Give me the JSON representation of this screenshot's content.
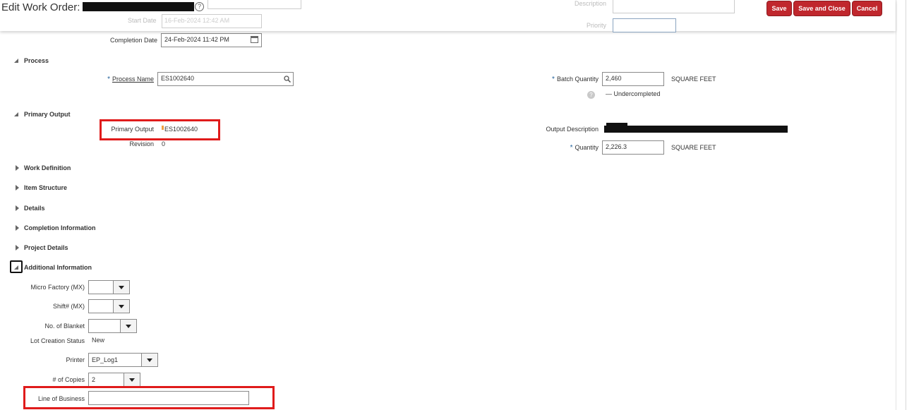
{
  "header": {
    "title": "Edit Work Order:",
    "help": "?",
    "start_date_label": "Start Date",
    "start_date_value": "16-Feb-2024 12:42 AM",
    "description_label": "Description",
    "priority_label": "Priority",
    "buttons": {
      "save": "Save",
      "save_close": "Save and Close",
      "cancel": "Cancel"
    }
  },
  "dates": {
    "completion_label": "Completion Date",
    "completion_value": "24-Feb-2024 11:42 PM"
  },
  "process": {
    "section": "Process",
    "name_label": "Process Name",
    "name_value": "ES1002640",
    "batch_qty_label": "Batch Quantity",
    "batch_qty_value": "2,460",
    "batch_uom": "SQUARE FEET",
    "undercompleted": "Undercompleted"
  },
  "primary_output": {
    "section": "Primary Output",
    "label": "Primary Output",
    "value": "ES1002640",
    "revision_label": "Revision",
    "revision_value": "0",
    "output_desc_label": "Output Description",
    "quantity_label": "Quantity",
    "quantity_value": "2,226.3",
    "quantity_uom": "SQUARE FEET"
  },
  "sections": [
    "Work Definition",
    "Item Structure",
    "Details",
    "Completion Information",
    "Project Details"
  ],
  "additional": {
    "section": "Additional Information",
    "micro_factory_label": "Micro Factory (MX)",
    "micro_factory_value": "",
    "shift_label": "Shift# (MX)",
    "shift_value": "",
    "blanket_label": "No. of Blanket",
    "blanket_value": "",
    "lot_status_label": "Lot Creation Status",
    "lot_status_value": "New",
    "printer_label": "Printer",
    "printer_value": "EP_Log1",
    "copies_label": "# of Copies",
    "copies_value": "2",
    "lob_label": "Line of Business",
    "lob_value": ""
  },
  "colors": {
    "button_red": "#c0272d",
    "highlight": "#e01b1b",
    "required": "#1f5f99"
  }
}
